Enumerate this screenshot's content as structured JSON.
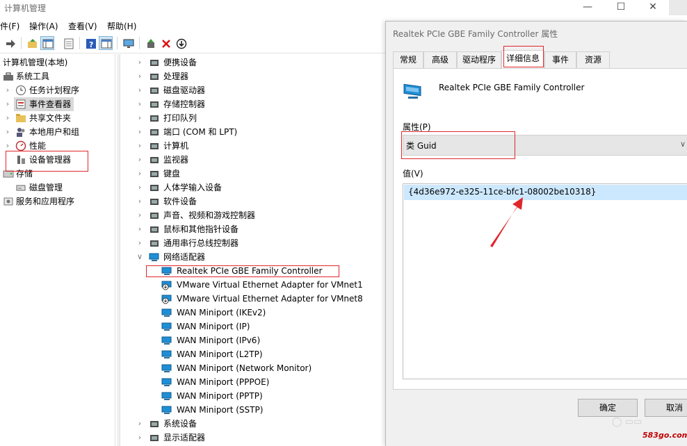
{
  "main_window": {
    "title": "计算机管理",
    "controls": {
      "minimize": "—",
      "maximize": "☐",
      "close": "✕"
    }
  },
  "menu": [
    "件(F)",
    "操作(A)",
    "查看(V)",
    "帮助(H)"
  ],
  "left_tree": [
    {
      "label": "计算机管理(本地)",
      "arrow": ""
    },
    {
      "label": "系统工具",
      "arrow": "∨"
    },
    {
      "label": "任务计划程序",
      "arrow": "›"
    },
    {
      "label": "事件查看器",
      "arrow": "›"
    },
    {
      "label": "共享文件夹",
      "arrow": "›"
    },
    {
      "label": "本地用户和组",
      "arrow": "›"
    },
    {
      "label": "性能",
      "arrow": "›"
    },
    {
      "label": "设备管理器",
      "arrow": ""
    },
    {
      "label": "存储",
      "arrow": ""
    },
    {
      "label": "磁盘管理",
      "arrow": ""
    },
    {
      "label": "服务和应用程序",
      "arrow": ""
    }
  ],
  "device_tree": [
    {
      "label": "便携设备",
      "arrow": "›",
      "indent": 0
    },
    {
      "label": "处理器",
      "arrow": "›",
      "indent": 0
    },
    {
      "label": "磁盘驱动器",
      "arrow": "›",
      "indent": 0
    },
    {
      "label": "存储控制器",
      "arrow": "›",
      "indent": 0
    },
    {
      "label": "打印队列",
      "arrow": "›",
      "indent": 0
    },
    {
      "label": "端口 (COM 和 LPT)",
      "arrow": "›",
      "indent": 0
    },
    {
      "label": "计算机",
      "arrow": "›",
      "indent": 0
    },
    {
      "label": "监视器",
      "arrow": "›",
      "indent": 0
    },
    {
      "label": "键盘",
      "arrow": "›",
      "indent": 0
    },
    {
      "label": "人体学输入设备",
      "arrow": "›",
      "indent": 0
    },
    {
      "label": "软件设备",
      "arrow": "›",
      "indent": 0
    },
    {
      "label": "声音、视频和游戏控制器",
      "arrow": "›",
      "indent": 0
    },
    {
      "label": "鼠标和其他指针设备",
      "arrow": "›",
      "indent": 0
    },
    {
      "label": "通用串行总线控制器",
      "arrow": "›",
      "indent": 0
    },
    {
      "label": "网络适配器",
      "arrow": "∨",
      "indent": 0
    },
    {
      "label": "Realtek PCIe GBE Family Controller",
      "arrow": "",
      "indent": 1
    },
    {
      "label": "VMware Virtual Ethernet Adapter for VMnet1",
      "arrow": "",
      "indent": 1
    },
    {
      "label": "VMware Virtual Ethernet Adapter for VMnet8",
      "arrow": "",
      "indent": 1
    },
    {
      "label": "WAN Miniport (IKEv2)",
      "arrow": "",
      "indent": 1
    },
    {
      "label": "WAN Miniport (IP)",
      "arrow": "",
      "indent": 1
    },
    {
      "label": "WAN Miniport (IPv6)",
      "arrow": "",
      "indent": 1
    },
    {
      "label": "WAN Miniport (L2TP)",
      "arrow": "",
      "indent": 1
    },
    {
      "label": "WAN Miniport (Network Monitor)",
      "arrow": "",
      "indent": 1
    },
    {
      "label": "WAN Miniport (PPPOE)",
      "arrow": "",
      "indent": 1
    },
    {
      "label": "WAN Miniport (PPTP)",
      "arrow": "",
      "indent": 1
    },
    {
      "label": "WAN Miniport (SSTP)",
      "arrow": "",
      "indent": 1
    },
    {
      "label": "系统设备",
      "arrow": "›",
      "indent": 0
    },
    {
      "label": "显示适配器",
      "arrow": "›",
      "indent": 0
    }
  ],
  "dialog": {
    "title": "Realtek PCIe GBE Family Controller 属性",
    "tabs": [
      "常规",
      "高级",
      "驱动程序",
      "详细信息",
      "事件",
      "资源"
    ],
    "active_tab": "详细信息",
    "device_name": "Realtek PCIe GBE Family Controller",
    "property_label": "属性(P)",
    "property_selected": "类 Guid",
    "value_label": "值(V)",
    "value": "{4d36e972-e325-11ce-bfc1-08002be10318}",
    "ok_label": "确定",
    "cancel_label": "取消"
  },
  "watermark": "583go.com",
  "colors": {
    "annotation_red": "#e0262b",
    "selection_blue": "#cce8ff",
    "network_icon": "#1e8fd6"
  }
}
